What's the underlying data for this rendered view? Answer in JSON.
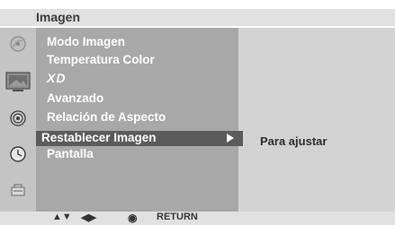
{
  "header": {
    "title": "Imagen"
  },
  "sidebar": {
    "icons": [
      "satellite-dish-icon",
      "picture-icon",
      "speaker-icon",
      "clock-icon",
      "lock-icon"
    ]
  },
  "menu": {
    "items": [
      {
        "label": "Modo Imagen"
      },
      {
        "label": "Temperatura Color"
      },
      {
        "label": "XD"
      },
      {
        "label": "Avanzado"
      },
      {
        "label": "Relación de Aspecto"
      },
      {
        "label": "Restablecer Imagen",
        "selected": true
      },
      {
        "label": "Pantalla"
      }
    ]
  },
  "right_panel": {
    "hint": "Para ajustar"
  },
  "footer": {
    "nav_arrows_ud": "▲▼",
    "nav_arrows_lr": "◀▶",
    "ok_symbol": "◉",
    "return_label": "RETURN"
  },
  "colors": {
    "menu_bg": "#a8a8a8",
    "selected_bg": "#5b5b5b",
    "header_bg": "#e1e1e1",
    "panel_bg": "#d3d3d3"
  }
}
